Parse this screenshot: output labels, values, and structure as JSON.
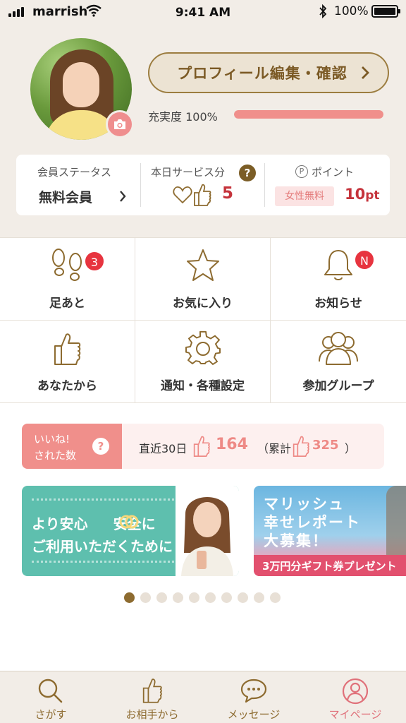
{
  "status_bar": {
    "carrier": "marrish",
    "time": "9:41 AM",
    "battery": "100%"
  },
  "profile": {
    "edit_button": "プロフィール編集・確認",
    "completion_label": "充実度 100%",
    "completion_fraction": 1.0
  },
  "stats": {
    "member_status_title": "会員ステータス",
    "member_status_value": "無料会員",
    "service_title": "本日サービス分",
    "service_help": "?",
    "service_count": "5",
    "points_title": "ポイント",
    "points_icon_letter": "P",
    "points_badge": "女性無料",
    "points_value": "10",
    "points_unit": "pt"
  },
  "menu": {
    "footprints": {
      "label": "足あと",
      "badge": "3"
    },
    "favorites": {
      "label": "お気に入り"
    },
    "notifications": {
      "label": "お知らせ",
      "badge": "N"
    },
    "from_you": {
      "label": "あなたから"
    },
    "settings": {
      "label": "通知・各種設定"
    },
    "groups": {
      "label": "参加グループ"
    }
  },
  "likes": {
    "tag_line1": "いいね!",
    "tag_line2": "された数",
    "help": "?",
    "recent_label": "直近30日",
    "recent_count": "164",
    "total_open": "（累計",
    "total_count": "325",
    "total_close": "）"
  },
  "banners": {
    "safety_line1_a": "より安心",
    "safety_line1_b": "安全に",
    "safety_line2": "ご利用いただくために",
    "report_line1": "マリッシュ",
    "report_line2": "幸せレポート",
    "report_line3": "大募集！",
    "report_strip": "3万円分ギフト券プレゼント"
  },
  "pager": {
    "count": 10,
    "active": 0
  },
  "tabs": [
    {
      "label": "さがす",
      "icon": "search-icon"
    },
    {
      "label": "お相手から",
      "icon": "thumbs-up-icon"
    },
    {
      "label": "メッセージ",
      "icon": "chat-icon"
    },
    {
      "label": "マイページ",
      "icon": "user-icon",
      "active": true
    }
  ],
  "colors": {
    "accent": "#8d6b30",
    "pink": "#f08f8b",
    "red": "#c5333b",
    "teal": "#5ebfae",
    "header_bg": "#f2ede7"
  }
}
